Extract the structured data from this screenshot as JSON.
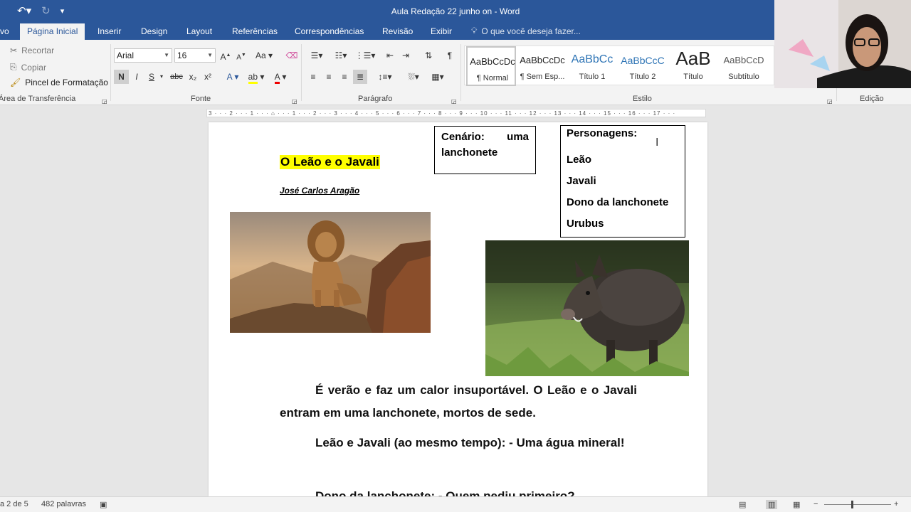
{
  "title_bar": {
    "document_title": "Aula Redação 22 junho on - Word",
    "qat_icons": [
      "undo-icon",
      "redo-icon",
      "customize-qat-icon"
    ]
  },
  "tabs": [
    {
      "label": "vo"
    },
    {
      "label": "Página Inicial"
    },
    {
      "label": "Inserir"
    },
    {
      "label": "Design"
    },
    {
      "label": "Layout"
    },
    {
      "label": "Referências"
    },
    {
      "label": "Correspondências"
    },
    {
      "label": "Revisão"
    },
    {
      "label": "Exibir"
    }
  ],
  "tell_me": {
    "placeholder": "O que você deseja fazer..."
  },
  "ribbon": {
    "clipboard": {
      "cut": "Recortar",
      "copy": "Copiar",
      "format_painter": "Pincel de Formatação",
      "group_label": "Área de Transferência"
    },
    "font": {
      "font_name": "Arial",
      "font_size": "16",
      "bold": "N",
      "italic": "I",
      "underline": "S",
      "strike": "abc",
      "subscript": "x₂",
      "superscript": "x²",
      "group_label": "Fonte"
    },
    "paragraph": {
      "group_label": "Parágrafo"
    },
    "styles": {
      "group_label": "Estilo",
      "items": [
        {
          "preview": "AaBbCcDc",
          "name": "¶ Normal"
        },
        {
          "preview": "AaBbCcDc",
          "name": "¶ Sem Esp..."
        },
        {
          "preview": "AaBbCc",
          "name": "Título 1"
        },
        {
          "preview": "AaBbCcC",
          "name": "Título 2"
        },
        {
          "preview": "AaB",
          "name": "Título"
        },
        {
          "preview": "AaBbCcD",
          "name": "Subtítulo"
        }
      ]
    },
    "editing": {
      "group_label": "Edição"
    }
  },
  "ruler": {
    "marks": "3 · · · 2 · · · 1 · · · ⌂ · · · 1 · · · 2 · · · 3 · · · 4 · · · 5 · · · 6 · · · 7 · · · 8 · · · 9 · · · 10 · · · 11 · · · 12 · · · 13 · · · 14 · · · 15 · · · 16 · · · 17 · · ·"
  },
  "document": {
    "heading": "O Leão e o Javali",
    "author": "José Carlos Aragão",
    "setting_box": "Cenário: uma lanchonete",
    "characters": [
      "Personagens:",
      "Leão",
      "Javali",
      "Dono da lanchonete",
      "Urubus"
    ],
    "paragraphs": [
      "É verão e faz um calor insuportável. O Leão e o Javali entram em uma lanchonete, mortos de sede.",
      "Leão e Javali (ao mesmo tempo): - Uma água mineral!",
      "Dono da lanchonete: - Quem pediu primeiro?"
    ]
  },
  "status_bar": {
    "page": "a 2 de 5",
    "words": "482 palavras"
  },
  "colors": {
    "word_blue": "#2b579a",
    "highlight": "#ffff00"
  }
}
